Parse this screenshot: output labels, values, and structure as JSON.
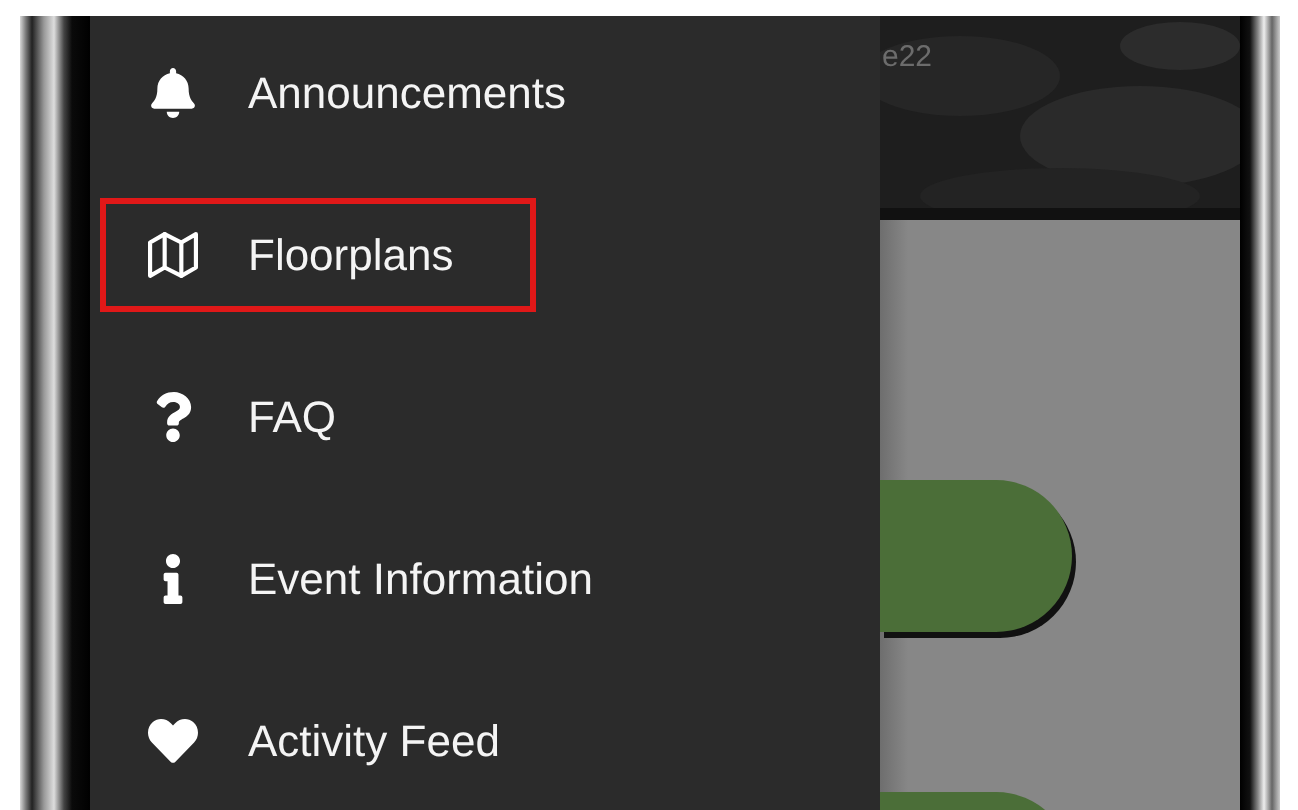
{
  "drawer": {
    "items": [
      {
        "kind": "bell",
        "label": "Announcements",
        "selected": false
      },
      {
        "kind": "map",
        "label": "Floorplans",
        "selected": true
      },
      {
        "kind": "question",
        "label": "FAQ",
        "selected": false
      },
      {
        "kind": "info",
        "label": "Event Information",
        "selected": false
      },
      {
        "kind": "heart",
        "label": "Activity Feed",
        "selected": false
      }
    ]
  },
  "content": {
    "header_text": "e22"
  }
}
